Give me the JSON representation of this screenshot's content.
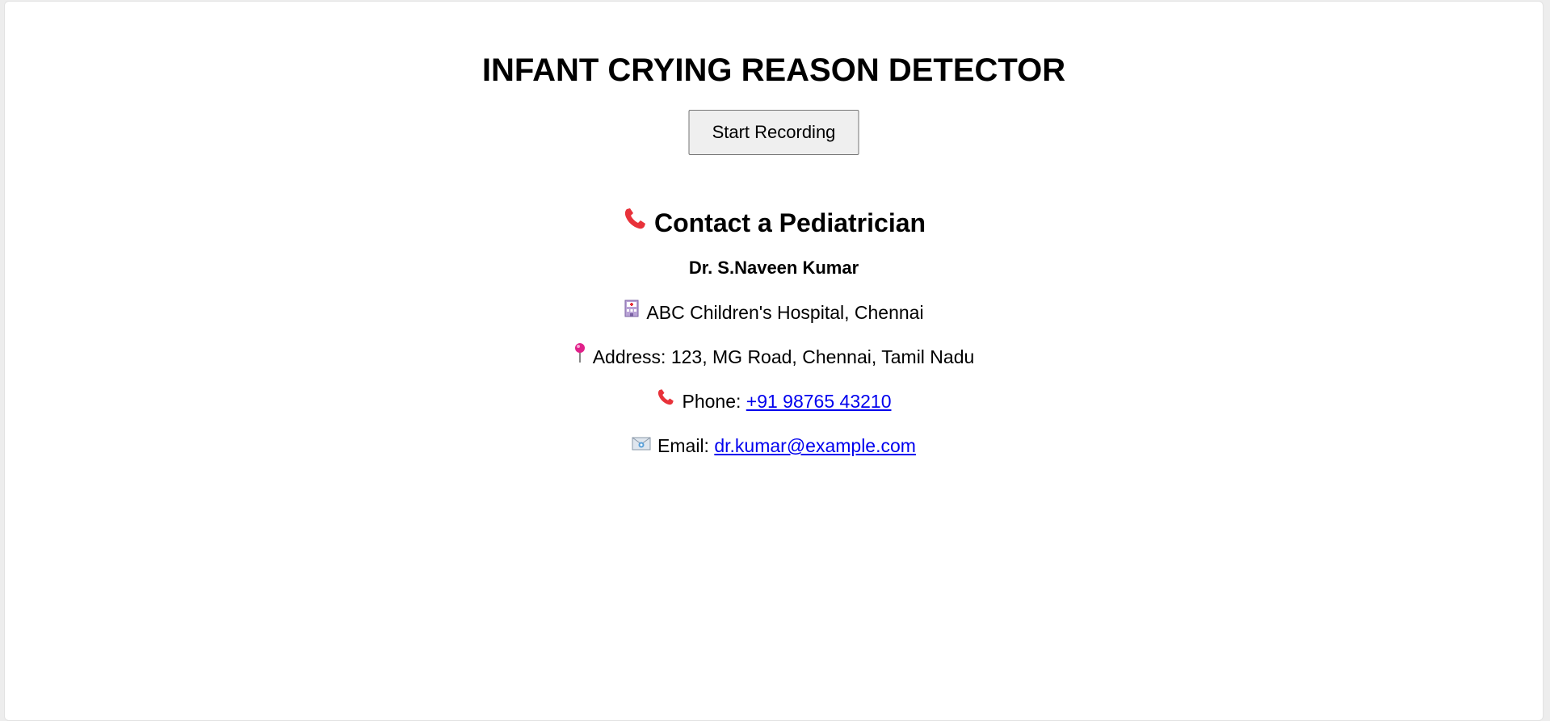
{
  "page": {
    "title": "INFANT CRYING REASON DETECTOR",
    "record_button_label": "Start Recording"
  },
  "contact": {
    "heading": "Contact a Pediatrician",
    "doctor_name": "Dr. S.Naveen Kumar",
    "hospital": "ABC Children's Hospital, Chennai",
    "address_label": "Address:",
    "address_value": "123, MG Road, Chennai, Tamil Nadu",
    "phone_label": "Phone:",
    "phone_value": "+91 98765 43210",
    "email_label": "Email:",
    "email_value": "dr.kumar@example.com"
  },
  "icons": {
    "heading_icon": "telephone-receiver-icon",
    "hospital_icon": "hospital-icon",
    "address_icon": "round-pushpin-icon",
    "phone_icon": "telephone-receiver-icon",
    "email_icon": "envelope-icon"
  },
  "colors": {
    "link": "#0000ee",
    "button_bg": "#efefef",
    "phone_icon": "#e8323a",
    "pin_icon": "#e0218a"
  }
}
